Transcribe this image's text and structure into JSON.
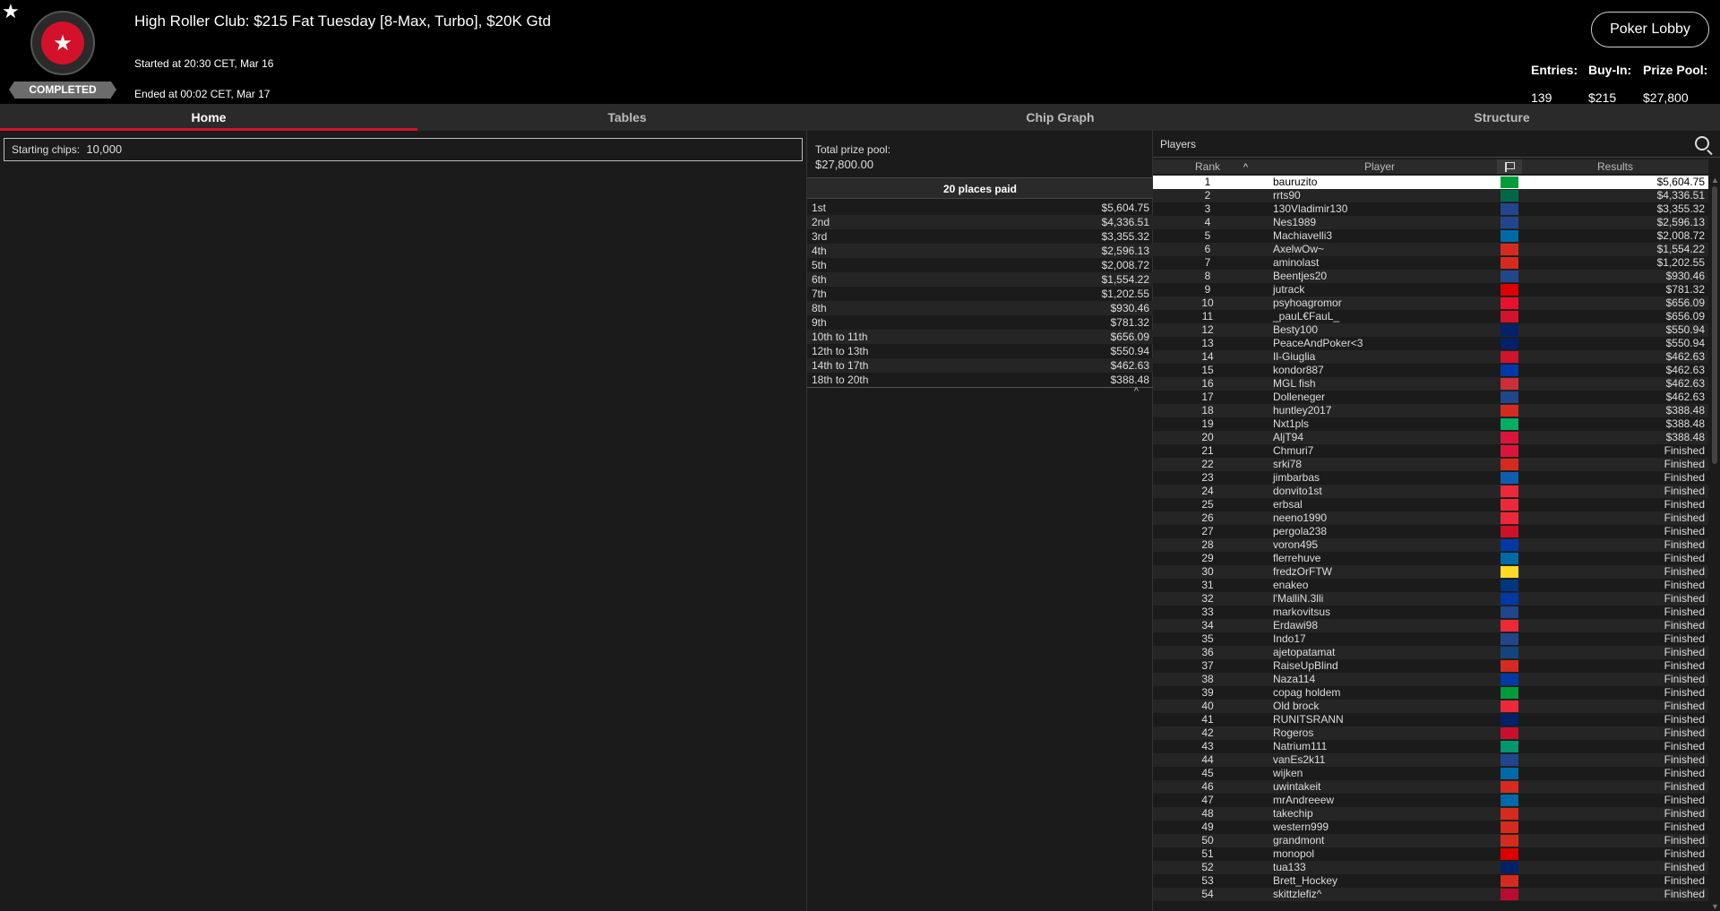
{
  "header": {
    "title": "High Roller Club: $215 Fat Tuesday [8-Max, Turbo], $20K Gtd",
    "started": "Started at 20:30 CET, Mar 16",
    "ended": "Ended at 00:02 CET, Mar 17",
    "status": "COMPLETED",
    "lobby_button": "Poker Lobby",
    "entries_label": "Entries:",
    "entries_value": "139",
    "buyin_label": "Buy-In:",
    "buyin_value": "$215",
    "prizepool_label": "Prize Pool:",
    "prizepool_value": "$27,800"
  },
  "tabs": [
    "Home",
    "Tables",
    "Chip Graph",
    "Structure"
  ],
  "home": {
    "starting_chips_label": "Starting chips:",
    "starting_chips_value": "10,000"
  },
  "prize": {
    "total_label": "Total prize pool:",
    "total_value": "$27,800.00",
    "places_paid": "20 places paid",
    "payouts": [
      [
        "1st",
        "$5,604.75"
      ],
      [
        "2nd",
        "$4,336.51"
      ],
      [
        "3rd",
        "$3,355.32"
      ],
      [
        "4th",
        "$2,596.13"
      ],
      [
        "5th",
        "$2,008.72"
      ],
      [
        "6th",
        "$1,554.22"
      ],
      [
        "7th",
        "$1,202.55"
      ],
      [
        "8th",
        "$930.46"
      ],
      [
        "9th",
        "$781.32"
      ],
      [
        "10th to 11th",
        "$656.09"
      ],
      [
        "12th to 13th",
        "$550.94"
      ],
      [
        "14th to 17th",
        "$462.63"
      ],
      [
        "18th to 20th",
        "$388.48"
      ]
    ]
  },
  "players": {
    "label": "Players",
    "col_rank": "Rank",
    "col_player": "Player",
    "col_results": "Results",
    "rows": [
      [
        "1",
        "bauruzito",
        "#009c3b",
        "$5,604.75"
      ],
      [
        "2",
        "rrts90",
        "#006847",
        "$4,336.51"
      ],
      [
        "3",
        "130Vladimir130",
        "#21468b",
        "$3,355.32"
      ],
      [
        "4",
        "Nes1989",
        "#21468b",
        "$2,596.13"
      ],
      [
        "5",
        "Machiavelli3",
        "#006aa7",
        "$2,008.72"
      ],
      [
        "6",
        "AxelwOw~",
        "#d52b1e",
        "$1,554.22"
      ],
      [
        "7",
        "aminolast",
        "#d52b1e",
        "$1,202.55"
      ],
      [
        "8",
        "Beentjes20",
        "#21468b",
        "$930.46"
      ],
      [
        "9",
        "jutrack",
        "#dd0000",
        "$781.32"
      ],
      [
        "10",
        "psyhoagromor",
        "#e8112d",
        "$656.09"
      ],
      [
        "11",
        "_pauL€FauL_",
        "#cf142b",
        "$656.09"
      ],
      [
        "12",
        "Besty100",
        "#012169",
        "$550.94"
      ],
      [
        "13",
        "PeaceAndPoker<3",
        "#012169",
        "$550.94"
      ],
      [
        "14",
        "Il-Giuglia",
        "#cf142b",
        "$462.63"
      ],
      [
        "15",
        "kondor887",
        "#0039a6",
        "$462.63"
      ],
      [
        "16",
        "MGL fish",
        "#cd2e3a",
        "$462.63"
      ],
      [
        "17",
        "Dolleneger",
        "#21468b",
        "$462.63"
      ],
      [
        "18",
        "huntley2017",
        "#d52b1e",
        "$388.48"
      ],
      [
        "19",
        "Nxt1pls",
        "#00af66",
        "$388.48"
      ],
      [
        "20",
        "AljT94",
        "#dc143c",
        "$388.48"
      ],
      [
        "21",
        "Chmuri7",
        "#dc143c",
        "Finished"
      ],
      [
        "22",
        "srki78",
        "#d52b1e",
        "Finished"
      ],
      [
        "23",
        "jimbarbas",
        "#0d5eaf",
        "Finished"
      ],
      [
        "24",
        "donvito1st",
        "#ed2939",
        "Finished"
      ],
      [
        "25",
        "erbsal",
        "#ed2939",
        "Finished"
      ],
      [
        "26",
        "neeno1990",
        "#ed2939",
        "Finished"
      ],
      [
        "27",
        "pergola238",
        "#ce1126",
        "Finished"
      ],
      [
        "28",
        "voron495",
        "#0039a6",
        "Finished"
      ],
      [
        "29",
        "flerrehuve",
        "#006aa7",
        "Finished"
      ],
      [
        "30",
        "fredzOrFTW",
        "#fdda24",
        "Finished"
      ],
      [
        "31",
        "enakeo",
        "#003580",
        "Finished"
      ],
      [
        "32",
        "l'MalliN.3lli",
        "#0039a6",
        "Finished"
      ],
      [
        "33",
        "markovitsus",
        "#21468b",
        "Finished"
      ],
      [
        "34",
        "Erdawi98",
        "#ed2939",
        "Finished"
      ],
      [
        "35",
        "Indo17",
        "#21468b",
        "Finished"
      ],
      [
        "36",
        "ajetopatamat",
        "#11457e",
        "Finished"
      ],
      [
        "37",
        "RaiseUpBlind",
        "#d52b1e",
        "Finished"
      ],
      [
        "38",
        "Naza114",
        "#0039a6",
        "Finished"
      ],
      [
        "39",
        "copag holdem",
        "#009c3b",
        "Finished"
      ],
      [
        "40",
        "Old brock",
        "#ed2939",
        "Finished"
      ],
      [
        "41",
        "RUNITSRANN",
        "#012169",
        "Finished"
      ],
      [
        "42",
        "Rogeros",
        "#c8102e",
        "Finished"
      ],
      [
        "43",
        "Natrium111",
        "#00966e",
        "Finished"
      ],
      [
        "44",
        "vanEs2k11",
        "#21468b",
        "Finished"
      ],
      [
        "45",
        "wijken",
        "#006aa7",
        "Finished"
      ],
      [
        "46",
        "uwintakeit",
        "#d52b1e",
        "Finished"
      ],
      [
        "47",
        "mrAndreeew",
        "#006aa7",
        "Finished"
      ],
      [
        "48",
        "takechip",
        "#d52b1e",
        "Finished"
      ],
      [
        "49",
        "western999",
        "#d52b1e",
        "Finished"
      ],
      [
        "50",
        "grandmont",
        "#d52b1e",
        "Finished"
      ],
      [
        "51",
        "monopol",
        "#dd0000",
        "Finished"
      ],
      [
        "52",
        "tua133",
        "#012169",
        "Finished"
      ],
      [
        "53",
        "Brett_Hockey",
        "#d52b1e",
        "Finished"
      ],
      [
        "54",
        "skittzlefiz^",
        "#ba0c2f",
        "Finished"
      ]
    ]
  }
}
